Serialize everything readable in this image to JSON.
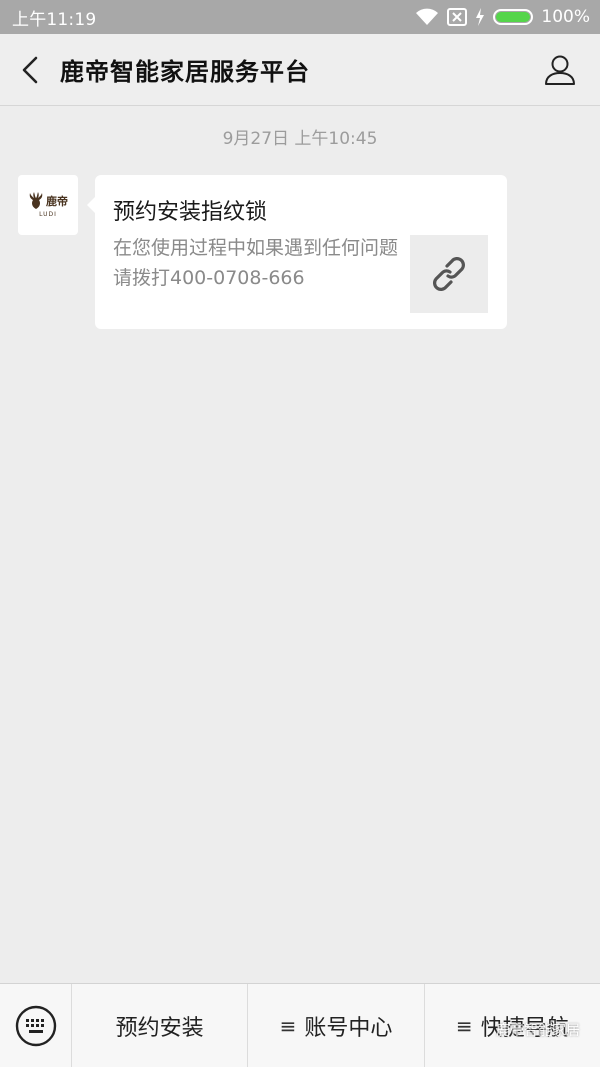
{
  "status_bar": {
    "time": "上午11:19",
    "battery_percent_label": "100%",
    "battery_level": 1.0,
    "icons": [
      "wifi-icon",
      "sim-icon",
      "charging-icon",
      "battery-icon"
    ]
  },
  "header": {
    "title": "鹿帝智能家居服务平台",
    "back_icon": "chevron-left-icon",
    "profile_icon": "person-icon"
  },
  "chat": {
    "timestamp": "9月27日 上午10:45",
    "avatar": {
      "logo_text": "鹿帝",
      "logo_subtext": "LUDI"
    },
    "message": {
      "title": "预约安装指纹锁",
      "description": "在您使用过程中如果遇到任何问题请拨打400-0708-666",
      "thumb_icon": "link-icon"
    }
  },
  "bottom_menu": {
    "keyboard_icon": "keyboard-icon",
    "items": [
      {
        "label": "预约安装",
        "has_submenu": false
      },
      {
        "label": "账号中心",
        "has_submenu": true
      },
      {
        "label": "快捷导航",
        "has_submenu": true
      }
    ],
    "submenu_glyph": "≡",
    "watermark": "鹿帝智能家居"
  },
  "colors": {
    "status_bar_bg": "#a8a8a8",
    "battery_green": "#55d54b",
    "background": "#ededed",
    "bubble_bg": "#ffffff"
  }
}
